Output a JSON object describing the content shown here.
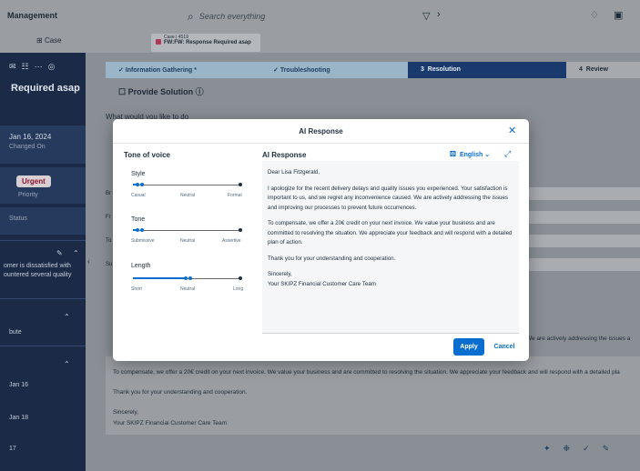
{
  "header": {
    "app_title": "Management",
    "search_placeholder": "Search everything",
    "right_icon_1": "bell-icon",
    "right_icon_2": "user-icon"
  },
  "tabs": {
    "case_label": "Case",
    "open_case_id": "Case | 4519",
    "open_case_title": "FW:FW: Response Required asap"
  },
  "sidebar": {
    "title": "Required asap",
    "date_value": "Jan 16, 2024",
    "date_key": "Changed On",
    "priority_value": "Urgent",
    "priority_key": "Priority",
    "status_key": "Status",
    "summary_line1": "omer is dissatisfied with",
    "summary_line2": "ountered several quality",
    "item_1": "bute",
    "item_2": "Jan 16",
    "item_3": "Jan 18",
    "item_4": "17"
  },
  "progress": {
    "step1": "Information Gathering *",
    "step2": "Troubleshooting",
    "step3": "Resolution",
    "step3_num": "3",
    "step4": "Review",
    "step4_num": "4"
  },
  "main": {
    "section_title": "Provide Solution",
    "question": "What would you like to do",
    "label_br": "Br",
    "label_fr": "Fr",
    "label_to": "To",
    "label_su": "Su",
    "peek_text": "We are actively addressing the issues a",
    "bg_p1": "To compensate, we offer a 20€ credit on your next invoice. We value your business and are committed to resolving the situation. We appreciate your feedback and will respond with a detailed pla",
    "bg_p2": "Thank you for your understanding and cooperation.",
    "bg_p3": "Sincerely,",
    "bg_p4": "Your SKIPZ Financial Customer Care Team"
  },
  "modal": {
    "title": "AI Response",
    "tone_heading": "Tone of voice",
    "response_heading": "AI Response",
    "language": "English",
    "apply_label": "Apply",
    "cancel_label": "Cancel",
    "sliders": [
      {
        "label": "Style",
        "min": "Casual",
        "mid": "Neutral",
        "max": "Formal",
        "value": 0.05
      },
      {
        "label": "Tone",
        "min": "Submissive",
        "mid": "Neutral",
        "max": "Assertive",
        "value": 0.05
      },
      {
        "label": "Length",
        "min": "Short",
        "mid": "Neutral",
        "max": "Long",
        "value": 0.5
      }
    ],
    "response_paragraphs": [
      "Dear Lisa Fitzgerald,",
      "I apologize for the recent delivery delays and quality issues you experienced. Your satisfaction is important to us, and we regret any inconvenience caused. We are actively addressing the issues and improving our processes to prevent future occurrences.",
      "To compensate, we offer a 20€ credit on your next invoice. We value your business and are committed to resolving the situation. We appreciate your feedback and will respond with a detailed plan of action.",
      "Thank you for your understanding and cooperation.",
      "Sincerely,\nYour SKIPZ Financial Customer Care Team"
    ]
  }
}
